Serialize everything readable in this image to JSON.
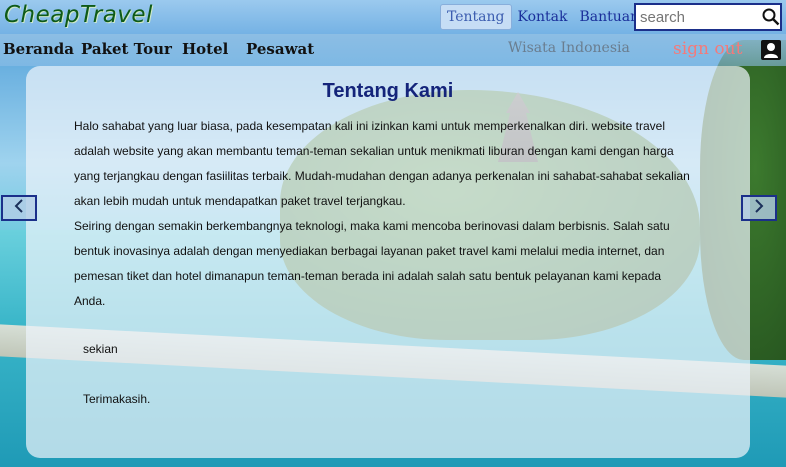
{
  "header": {
    "logo": "CheapTravel",
    "links": [
      "Tentang",
      "Kontak",
      "Bantuan"
    ],
    "search_placeholder": "search"
  },
  "nav": {
    "items": [
      "Beranda",
      "Paket Tour",
      "Hotel",
      "Pesawat"
    ],
    "subtitle": "Wisata Indonesia",
    "signout": "sign out"
  },
  "about": {
    "title": "Tentang Kami",
    "paragraph1": "Halo sahabat yang luar biasa, pada kesempatan kali ini izinkan kami untuk memperkenalkan diri. website travel adalah website yang akan membantu teman-teman sekalian untuk menikmati liburan dengan kami dengan harga yang terjangkau dengan fasiilitas terbaik. Mudah-mudahan dengan adanya perkenalan ini sahabat-sahabat sekalian akan lebih mudah untuk mendapatkan paket travel terjangkau.",
    "paragraph2": "Seiring dengan semakin berkembangnya teknologi, maka kami mencoba berinovasi dalam berbisnis. Salah satu bentuk inovasinya adalah dengan menyediakan berbagai layanan paket travel kami melalui media internet, dan pemesan tiket dan hotel dimanapun teman-teman berada ini adalah salah satu bentuk pelayanan kami kepada Anda.",
    "closing1": "sekian",
    "closing2": "Terimakasih."
  },
  "icons": {
    "search": "search-icon",
    "user": "user-icon",
    "prev": "chevron-left-icon",
    "next": "chevron-right-icon"
  },
  "colors": {
    "brand_green": "#0e5a18",
    "link_blue": "#1a2f9a",
    "signout": "#f47a7a",
    "title": "#14247a"
  }
}
